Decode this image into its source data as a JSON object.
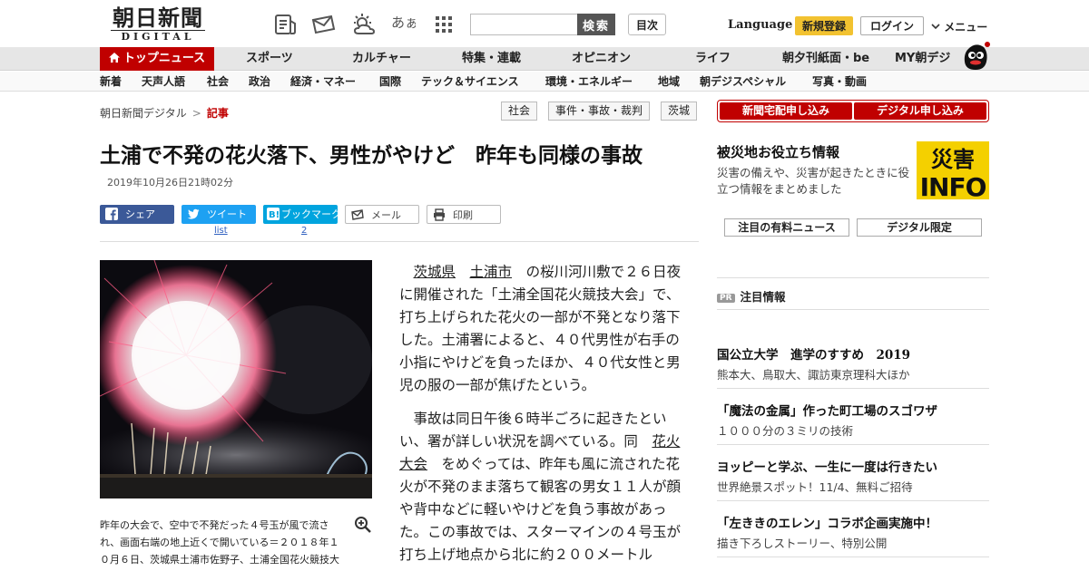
{
  "header": {
    "logo_jp": "朝日新聞",
    "logo_en": "DIGITAL",
    "search_button": "検索",
    "search_placeholder": "",
    "toc_button": "目次",
    "language": "Language",
    "register": "新規登録",
    "login": "ログイン",
    "menu": "メニュー",
    "icons": [
      "newspaper-icon",
      "mail-icon",
      "weather-icon",
      "font-size-icon",
      "grid-menu-icon"
    ],
    "font_icon_text": "あぁ"
  },
  "global_nav": {
    "top_news": "トップニュース",
    "items": [
      "スポーツ",
      "カルチャー",
      "特集・連載",
      "オピニオン",
      "ライフ",
      "朝夕刊紙面・be",
      "MY朝デジ"
    ]
  },
  "sub_nav": {
    "items": [
      "新着",
      "天声人語",
      "社会",
      "政治",
      "経済・マネー",
      "国際",
      "テック＆サイエンス",
      "環境・エネルギー",
      "地域",
      "朝デジスペシャル",
      "写真・動画"
    ]
  },
  "breadcrumb": {
    "home": "朝日新聞デジタル",
    "separator": ">",
    "current": "記事"
  },
  "tags": [
    "社会",
    "事件・事故・裁判",
    "茨城"
  ],
  "article": {
    "title": "土浦で不発の花火落下、男性がやけど　昨年も同様の事故",
    "date": "2019年10月26日21時02分",
    "share": {
      "facebook": "シェア",
      "tweet": "ツイート",
      "tweet_count": "list",
      "hatena_label": "ブックマーク",
      "hatena_count": "2",
      "mail": "メール",
      "print": "印刷"
    },
    "caption": "昨年の大会で、空中で不発だった４号玉が風で流され、画面右端の地上近くで開いている＝２０１８年１０月６日、茨城県土浦市佐野子、土浦全国花火競技大会実行委員会提供",
    "p1_link1": "茨城県",
    "p1_link2": "土浦市",
    "p1_rest": "の桜川河川敷で２６日夜に開催された「土浦全国花火競技大会」で、打ち上げられた花火の一部が不発となり落下した。土浦署によると、４０代男性が右手の小指にやけどを負ったほか、４０代女性と男児の服の一部が焦げたという。",
    "p2_start": "事故は同日午後６時半ごろに起きたといい、署が詳しい状況を調べている。同",
    "p2_link": "花火大会",
    "p2_rest": "をめぐっては、昨年も風に流された花火が不発のまま落ちて観客の男女１１人が顔や背中などに軽いやけどを負う事故があった。この事故では、スターマインの４号玉が打ち上げ地点から北に約２００メートル"
  },
  "sidebar": {
    "subscribe_paper": "新聞宅配申し込み",
    "subscribe_digital": "デジタル申し込み",
    "saigai_title": "被災地お役立ち情報",
    "saigai_desc": "災害の備えや、災害が起きたときに役立つ情報をまとめました",
    "saigai_logo_top": "災害",
    "saigai_logo_bottom": "INFO",
    "paid_news": "注目の有料ニュース",
    "digital_only": "デジタル限定",
    "pr_badge": "PR",
    "pr_title": "注目情報",
    "promos": [
      {
        "headline": "国公立大学　進学のすすめ　2019",
        "sub": "熊本大、鳥取大、諏訪東京理科大ほか"
      },
      {
        "headline": "「魔法の金属」作った町工場のスゴワザ",
        "sub": "１０００分の３ミリの技術"
      },
      {
        "headline": "ヨッピーと学ぶ、一生に一度は行きたい",
        "sub": "世界絶景スポット！11/4、無料ご招待"
      },
      {
        "headline": "「左ききのエレン」コラボ企画実施中！",
        "sub": "描き下ろしストーリー、特別公開"
      }
    ]
  },
  "colors": {
    "brand_red": "#c00000",
    "facebook": "#3b5998",
    "twitter": "#1da1f2",
    "hatena": "#00a4de",
    "register_yellow": "#f2c230"
  }
}
